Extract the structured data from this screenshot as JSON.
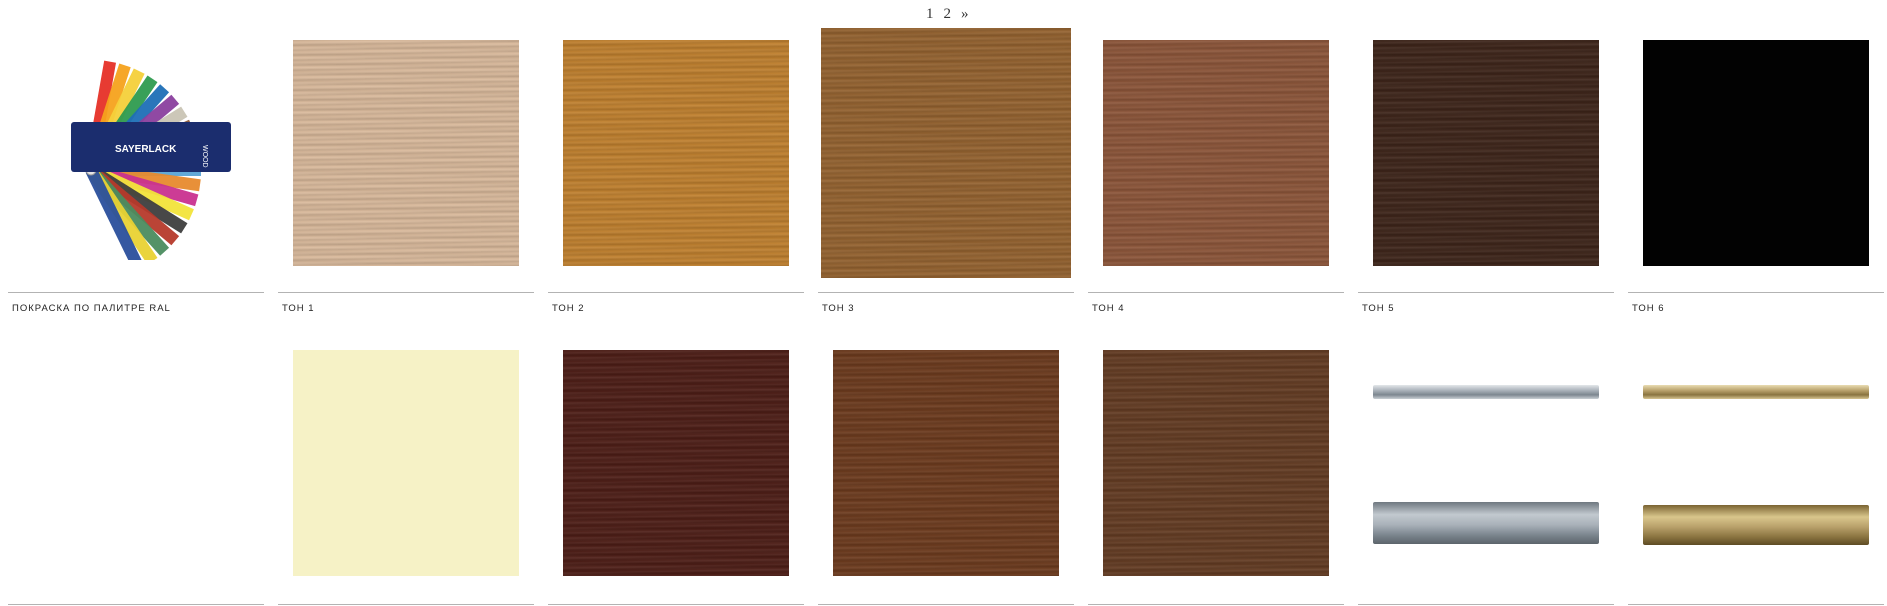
{
  "pagination": {
    "pages": [
      "1",
      "2"
    ],
    "next": "»"
  },
  "row1": [
    {
      "label": "ПОКРАСКА ПО ПАЛИТРЕ RAL",
      "kind": "fan",
      "fan_brand": "SAYERLACK",
      "fan_sub": "WOOD"
    },
    {
      "label": "ТОН 1",
      "color": "#d9b99b"
    },
    {
      "label": "ТОН 2",
      "color": "#c0802e"
    },
    {
      "label": "ТОН 3",
      "color": "#94622f"
    },
    {
      "label": "ТОН 4",
      "color": "#8c5539"
    },
    {
      "label": "ТОН 5",
      "color": "#3d2419"
    },
    {
      "label": "ТОН 6",
      "color": "#020202"
    }
  ],
  "row2": [
    {
      "kind": "empty"
    },
    {
      "color": "#f6f2c6"
    },
    {
      "color": "#4d1d16"
    },
    {
      "color": "#6c3a1d"
    },
    {
      "color": "#633b22"
    },
    {
      "kind": "rail",
      "color": "#a8b0b8",
      "accent": "#7d8790"
    },
    {
      "kind": "rail",
      "color": "#b8a06a",
      "accent": "#8a7440"
    }
  ],
  "colors": {
    "divider": "#b3b3b3",
    "text": "#222222",
    "fan_card": "#1b2d6e"
  }
}
